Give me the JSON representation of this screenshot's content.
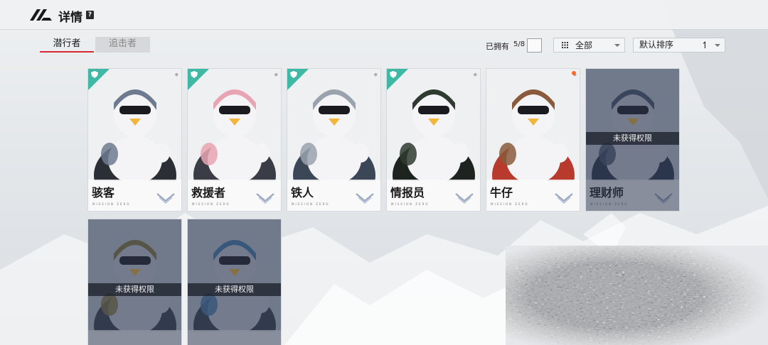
{
  "header": {
    "title": "详情",
    "help_glyph": "?"
  },
  "tabs": [
    {
      "label": "潜行者",
      "active": true
    },
    {
      "label": "追击者",
      "active": false
    }
  ],
  "controls": {
    "owned_label": "已拥有",
    "owned_count": "5/8",
    "filter_value": "全部",
    "sort_value": "默认排序",
    "sort_direction_glyph": "↿"
  },
  "card_subtitle": "MISSION ZERO",
  "cards": [
    {
      "name": "骇客",
      "owned": true,
      "badge": true,
      "palette": [
        "#6d7a90",
        "#2b2e35",
        "#f4f4f6"
      ]
    },
    {
      "name": "救援者",
      "owned": true,
      "badge": true,
      "palette": [
        "#e8a4b2",
        "#3a3d45",
        "#f4f4f6"
      ]
    },
    {
      "name": "铁人",
      "owned": true,
      "badge": true,
      "palette": [
        "#9aa2ae",
        "#3b4657",
        "#f4f4f6"
      ]
    },
    {
      "name": "情报员",
      "owned": true,
      "badge": true,
      "palette": [
        "#2f3b30",
        "#1d241f",
        "#f4f4f6"
      ]
    },
    {
      "name": "牛仔",
      "owned": true,
      "badge": false,
      "notification": true,
      "palette": [
        "#8a5a3c",
        "#b73a2c",
        "#f4f4f6"
      ]
    },
    {
      "name": "理财师",
      "owned": false,
      "locked_label": "未获得权限",
      "palette": [
        "#4b5670",
        "#2c3347",
        "#c9ced8"
      ]
    },
    {
      "name": "",
      "owned": false,
      "locked_label": "未获得权限",
      "palette": [
        "#8b7a3e",
        "#3a3f4c",
        "#c9ced8"
      ]
    },
    {
      "name": "",
      "owned": false,
      "locked_label": "未获得权限",
      "palette": [
        "#4b7fb0",
        "#3a3f4c",
        "#c9ced8"
      ]
    }
  ],
  "colors": {
    "accent_red": "#d52a32",
    "badge_teal": "#3fb8a5",
    "notification_orange": "#ff6a2a"
  }
}
